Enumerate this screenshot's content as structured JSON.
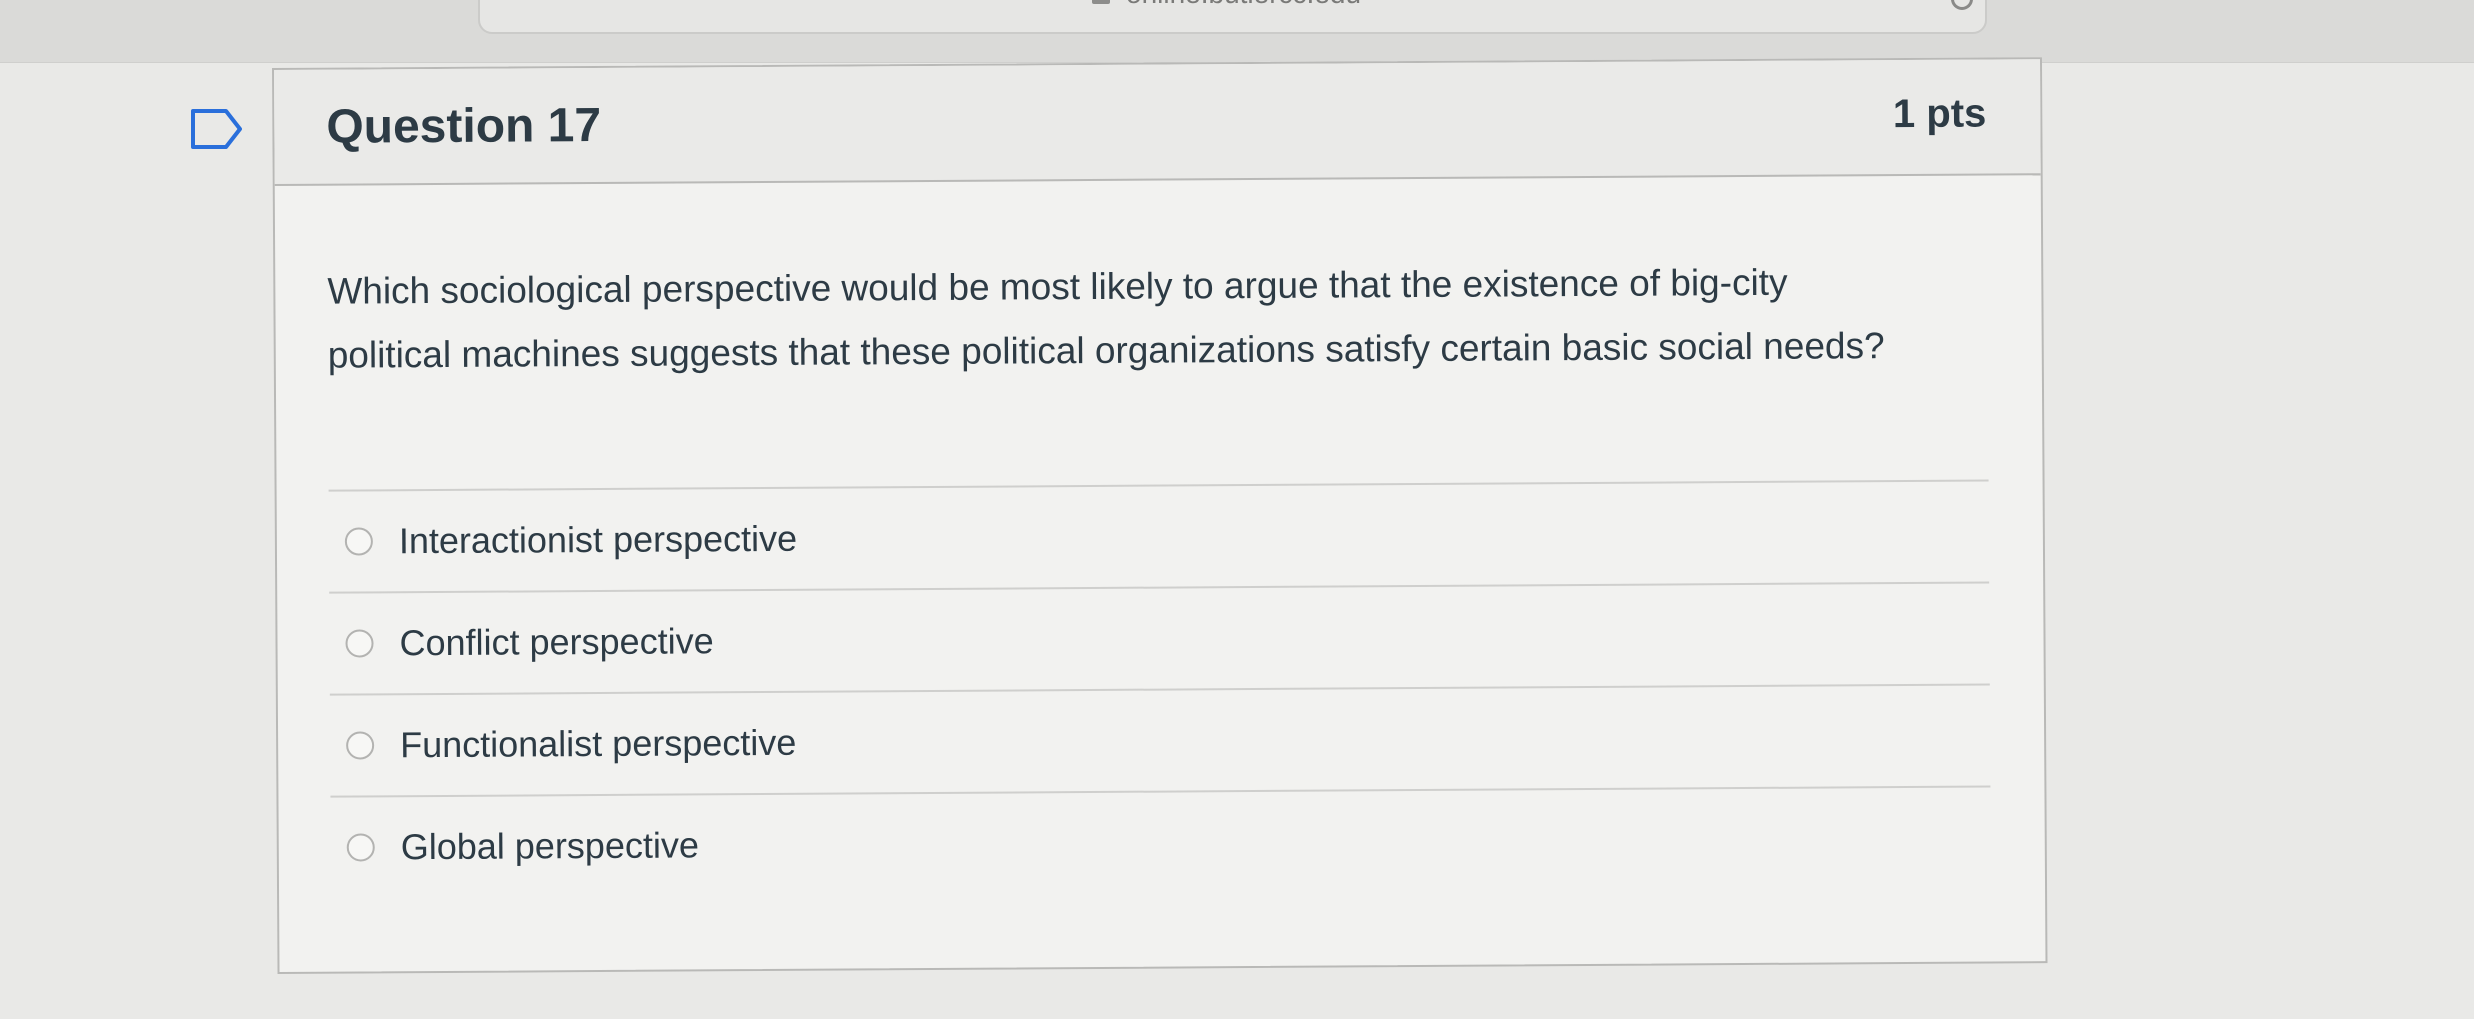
{
  "browser": {
    "url": "online.butlercc.edu"
  },
  "question": {
    "title": "Question 17",
    "points": "1 pts",
    "text": "Which sociological perspective would be most likely to argue that the existence of big-city political machines suggests that these political organizations satisfy certain basic social needs?",
    "answers": [
      {
        "label": "Interactionist perspective",
        "selected": false
      },
      {
        "label": "Conflict perspective",
        "selected": false
      },
      {
        "label": "Functionalist perspective",
        "selected": false
      },
      {
        "label": "Global perspective",
        "selected": false
      }
    ]
  },
  "icons": {
    "flag": "flag-icon",
    "reload": "reload-icon",
    "lock": "lock-icon"
  }
}
